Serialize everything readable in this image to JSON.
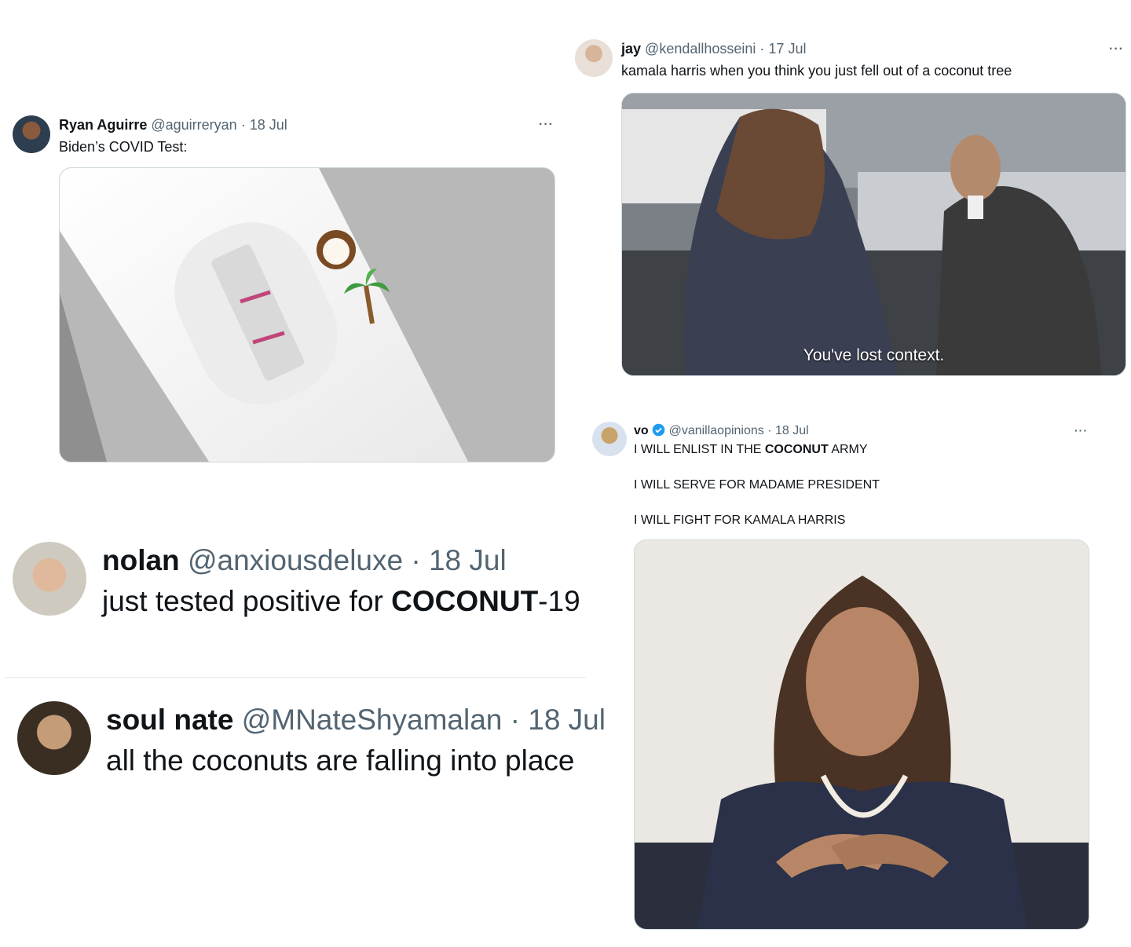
{
  "tweets": [
    {
      "name": "Ryan Aguirre",
      "handle": "@aguirreryan",
      "date": "· 18 Jul",
      "text": "Biden’s COVID Test:",
      "more": "···"
    },
    {
      "name": "jay",
      "handle": "@kendallhosseini",
      "date": "· 17 Jul",
      "text": "kamala harris when you think you just fell out of a coconut tree",
      "more": "···",
      "media_caption": "You've lost context."
    },
    {
      "name": "vo",
      "handle": "@vanillaopinions",
      "date": "· 18 Jul",
      "verified": true,
      "more": "···",
      "lines": [
        {
          "before": "I WILL ENLIST IN THE ",
          "bold": "COCONUT",
          "after": " ARMY"
        },
        {
          "text": "I WILL SERVE FOR MADAME PRESIDENT"
        },
        {
          "text": "I WILL FIGHT FOR KAMALA HARRIS"
        }
      ]
    },
    {
      "name": "nolan",
      "handle": "@anxiousdeluxe",
      "date": "· 18 Jul",
      "text_before": "just tested positive for ",
      "text_bold": "COCONUT",
      "text_after": "-19"
    },
    {
      "name": "soul nate",
      "handle": "@MNateShyamalan",
      "date": "· 18 Jul",
      "text": "all the coconuts are falling into place"
    }
  ],
  "colors": {
    "handle_gray": "#536471",
    "verified_blue": "#1d9bf0",
    "test_line": "#c0457a"
  },
  "icons": [
    "coconut-icon",
    "palm-tree-icon",
    "verified-badge-icon",
    "more-options-icon"
  ]
}
